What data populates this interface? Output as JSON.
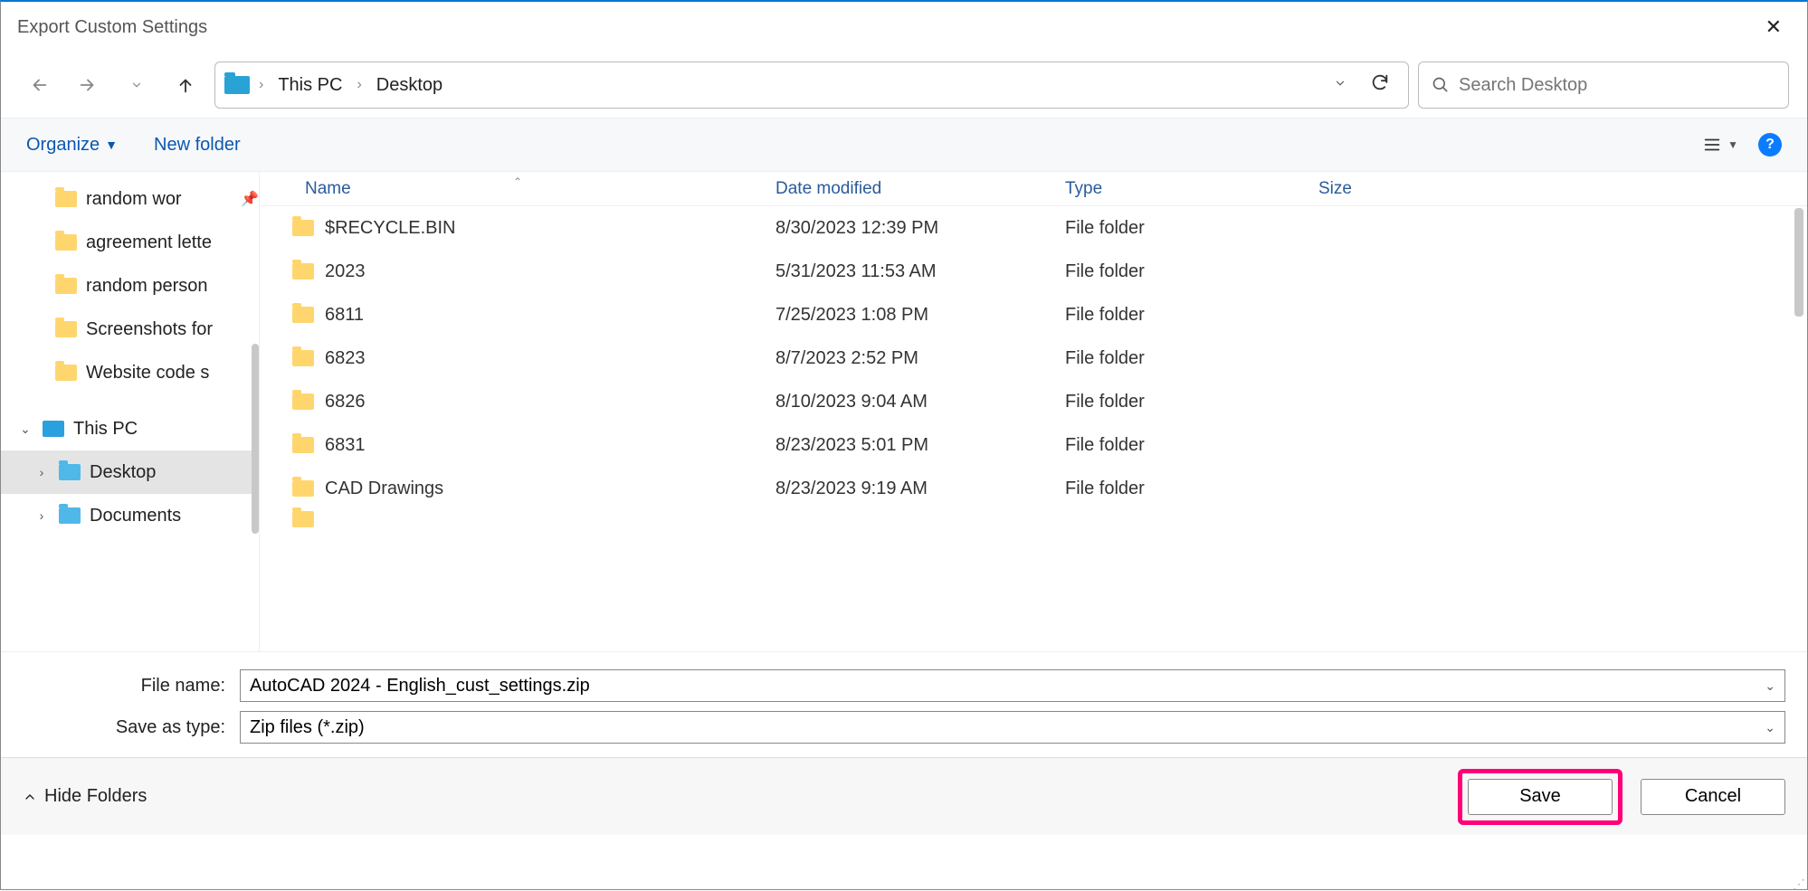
{
  "window": {
    "title": "Export Custom Settings"
  },
  "breadcrumb": {
    "items": [
      "This PC",
      "Desktop"
    ]
  },
  "search": {
    "placeholder": "Search Desktop"
  },
  "toolbar": {
    "organize": "Organize",
    "newfolder": "New folder"
  },
  "sidebar": {
    "quick": [
      {
        "label": "random wor",
        "pinned": true
      },
      {
        "label": "agreement lette"
      },
      {
        "label": "random person"
      },
      {
        "label": "Screenshots for"
      },
      {
        "label": "Website code s"
      }
    ],
    "thispc": "This PC",
    "children": [
      {
        "label": "Desktop",
        "selected": true
      },
      {
        "label": "Documents"
      }
    ]
  },
  "columns": {
    "name": "Name",
    "date": "Date modified",
    "type": "Type",
    "size": "Size"
  },
  "files": [
    {
      "name": "$RECYCLE.BIN",
      "date": "8/30/2023 12:39 PM",
      "type": "File folder"
    },
    {
      "name": "2023",
      "date": "5/31/2023 11:53 AM",
      "type": "File folder"
    },
    {
      "name": "6811",
      "date": "7/25/2023 1:08 PM",
      "type": "File folder"
    },
    {
      "name": "6823",
      "date": "8/7/2023 2:52 PM",
      "type": "File folder"
    },
    {
      "name": "6826",
      "date": "8/10/2023 9:04 AM",
      "type": "File folder"
    },
    {
      "name": "6831",
      "date": "8/23/2023 5:01 PM",
      "type": "File folder"
    },
    {
      "name": "CAD Drawings",
      "date": "8/23/2023 9:19 AM",
      "type": "File folder"
    }
  ],
  "fields": {
    "filename_label": "File name:",
    "filename_value": "AutoCAD 2024 - English_cust_settings.zip",
    "savetype_label": "Save as type:",
    "savetype_value": "Zip files (*.zip)"
  },
  "footer": {
    "hide": "Hide Folders",
    "save": "Save",
    "cancel": "Cancel"
  }
}
